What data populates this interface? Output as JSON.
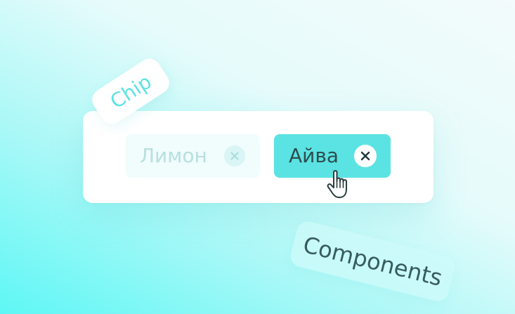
{
  "tags": {
    "chip_label": "Chip",
    "components_label": "Components"
  },
  "chips": {
    "disabled": {
      "label": "Лимон",
      "state": "disabled",
      "icon": "close-icon"
    },
    "active": {
      "label": "Айва",
      "state": "hover",
      "icon": "close-icon"
    }
  },
  "cursor": {
    "icon": "pointer-hand-icon"
  },
  "colors": {
    "accent": "#5be3e3",
    "disabled_bg": "#f1fcfc",
    "disabled_text": "#b8e0e0",
    "active_text": "#2f4d4f",
    "components_text": "#385c5d"
  }
}
